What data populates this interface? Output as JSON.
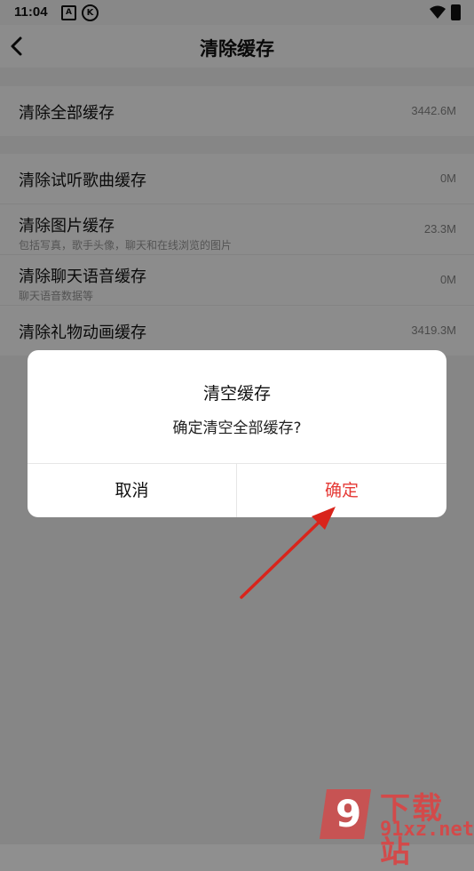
{
  "status": {
    "time": "11:04",
    "icon_a": "A",
    "icon_k": "K"
  },
  "nav": {
    "title": "清除缓存",
    "back_icon": "back-arrow-icon"
  },
  "sections": [
    {
      "rows": [
        {
          "title": "清除全部缓存",
          "value": "3442.6M"
        }
      ]
    },
    {
      "rows": [
        {
          "title": "清除试听歌曲缓存",
          "value": "0M"
        },
        {
          "title": "清除图片缓存",
          "subtitle": "包括写真，歌手头像，聊天和在线浏览的图片",
          "value": "23.3M"
        },
        {
          "title": "清除聊天语音缓存",
          "subtitle": "聊天语音数据等",
          "value": "0M"
        },
        {
          "title": "清除礼物动画缓存",
          "value": "3419.3M"
        }
      ]
    }
  ],
  "dialog": {
    "title": "清空缓存",
    "message": "确定清空全部缓存?",
    "cancel_label": "取消",
    "confirm_label": "确定"
  },
  "colors": {
    "accent": "#e53935",
    "arrow": "#d9241b"
  },
  "watermark": {
    "brand": "下载站",
    "url": "91xz.net",
    "logo_text": "9"
  }
}
